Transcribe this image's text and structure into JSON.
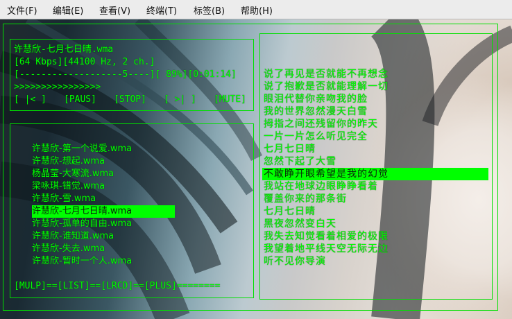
{
  "menu": [
    {
      "label": "文件(F)"
    },
    {
      "label": "编辑(E)"
    },
    {
      "label": "查看(V)"
    },
    {
      "label": "终端(T)"
    },
    {
      "label": "标签(B)"
    },
    {
      "label": "帮助(H)"
    }
  ],
  "player": {
    "now_playing": "许慧欣-七月七日晴.wma",
    "info": "[64 Kbps][44100 Hz, 2 ch.]",
    "progress_text": "[-------------------5----][ 89%][0:01:14]",
    "progress_fraction": 0.89,
    "elapsed": "0:01:14",
    "seek_bar": ">>>>>>>>>>>>>>>>",
    "controls": [
      "[ |< ]",
      "[PAUS]",
      "[STOP]",
      "[ >| ]",
      "[MUTE]"
    ]
  },
  "playlist": {
    "items": [
      "许慧欣-第一个说爱.wma",
      "许慧欣-想起.wma",
      "杨晶莹-大寒流.wma",
      "梁咏琪-错觉.wma",
      "许慧欣-雪.wma",
      "许慧欣-七月七日晴.wma",
      "许慧欣-孤单的自由.wma",
      "许慧欣-谁知道.wma",
      "许慧欣-失去.wma",
      "许慧欣-暂时一个人.wma"
    ],
    "current_index": 5,
    "footer": "[MULP]==[LIST]==[LRCD]==[PLUS]========"
  },
  "lyrics": {
    "lines": [
      "说了再见是否就能不再想念",
      "说了抱歉是否就能理解一切",
      "眼泪代替你亲吻我的脸",
      "我的世界忽然漫天白雪",
      "拇指之间还残留你的昨天",
      "一片一片怎么听见完全",
      "七月七日晴",
      "忽然下起了大雪",
      "不敢睁开眼希望是我的幻觉",
      "我站在地球边眼睁睁看着",
      "覆盖你来的那条街",
      "七月七日晴",
      "黑夜忽然变白天",
      "我失去知觉看着相爱的极限",
      "我望着地平线天空无际无边",
      "听不见你导演"
    ],
    "current_index": 8
  }
}
